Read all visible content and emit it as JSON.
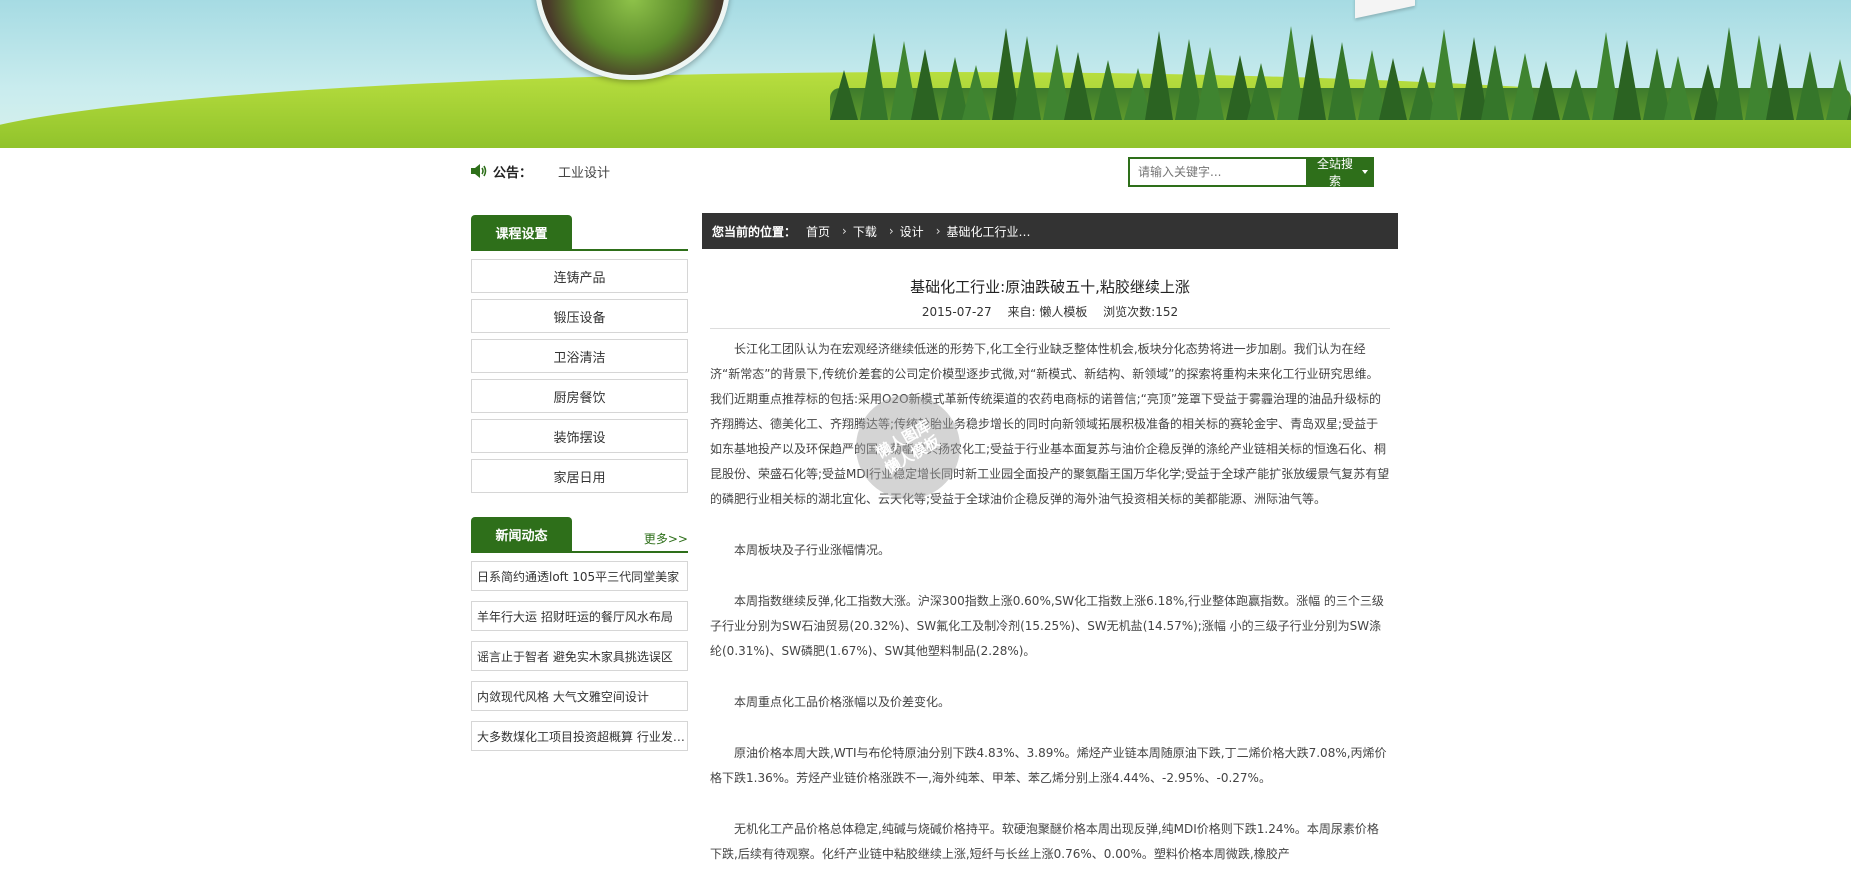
{
  "notice": {
    "label": "公告：",
    "text": "工业设计"
  },
  "search": {
    "placeholder": "请输入关键字...",
    "button_label": "全站搜索"
  },
  "sidebar": {
    "courses_title": "课程设置",
    "courses": [
      "连铸产品",
      "锻压设备",
      "卫浴清洁",
      "厨房餐饮",
      "装饰摆设",
      "家居日用"
    ],
    "news_title": "新闻动态",
    "news_more": "更多>>",
    "news": [
      "日系简约通透loft 105平三代同堂美家",
      "羊年行大运 招财旺运的餐厅风水布局",
      "谣言止于智者 避免实木家具挑选误区",
      "内敛现代风格 大气文雅空间设计",
      "大多数煤化工项目投资超概算 行业发…"
    ]
  },
  "breadcrumb": {
    "lead": "您当前的位置：",
    "items": [
      "首页",
      "下载",
      "设计",
      "基础化工行业…"
    ]
  },
  "article": {
    "title": "基础化工行业:原油跌破五十,粘胶继续上涨",
    "date": "2015-07-27",
    "source": "来自: 懒人模板",
    "views": "浏览次数:152",
    "paragraphs": [
      "长江化工团队认为在宏观经济继续低迷的形势下,化工全行业缺乏整体性机会,板块分化态势将进一步加剧。我们认为在经济“新常态”的背景下,传统价差套的公司定价模型逐步式微,对“新模式、新结构、新领域”的探索将重构未来化工行业研究思维。我们近期重点推荐标的包括:采用O2O新模式革新传统渠道的农药电商标的诺普信;“亮顶”笼罩下受益于雾霾治理的油品升级标的齐翔腾达、德美化工、齐翔腾达等;传统轮胎业务稳步增长的同时向新领域拓展积极准备的相关标的赛轮金宇、青岛双星;受益于如东基地投产以及环保趋严的国内菊酯龙头扬农化工;受益于行业基本面复苏与油价企稳反弹的涤纶产业链相关标的恒逸石化、桐昆股份、荣盛石化等;受益MDI行业稳定增长同时新工业园全面投产的聚氨酯王国万华化学;受益于全球产能扩张放缓景气复苏有望的磷肥行业相关标的湖北宜化、云天化等;受益于全球油价企稳反弹的海外油气投资相关标的美都能源、洲际油气等。",
      "本周板块及子行业涨幅情况。",
      "本周指数继续反弹,化工指数大涨。沪深300指数上涨0.60%,SW化工指数上涨6.18%,行业整体跑赢指数。涨幅 的三个三级子行业分别为SW石油贸易(20.32%)、SW氟化工及制冷剂(15.25%)、SW无机盐(14.57%);涨幅 小的三级子行业分别为SW涤纶(0.31%)、SW磷肥(1.67%)、SW其他塑料制品(2.28%)。",
      "本周重点化工品价格涨幅以及价差变化。",
      "原油价格本周大跌,WTI与布伦特原油分别下跌4.83%、3.89%。烯烃产业链本周随原油下跌,丁二烯价格大跌7.08%,丙烯价格下跌1.36%。芳烃产业链价格涨跌不一,海外纯苯、甲苯、苯乙烯分别上涨4.44%、-2.95%、-0.27%。",
      "无机化工产品价格总体稳定,纯碱与烧碱价格持平。软硬泡聚醚价格本周出现反弹,纯MDI价格则下跌1.24%。本周尿素价格下跌,后续有待观察。化纤产业链中粘胶继续上涨,短纤与长丝上涨0.76%、0.00%。塑料价格本周微跌,橡胶产"
    ]
  },
  "watermark": {
    "line1": "懒人图库",
    "line2": "懒人模板"
  },
  "colors": {
    "brand_green": "#2e6f1a",
    "crumb_bg": "#333333"
  }
}
